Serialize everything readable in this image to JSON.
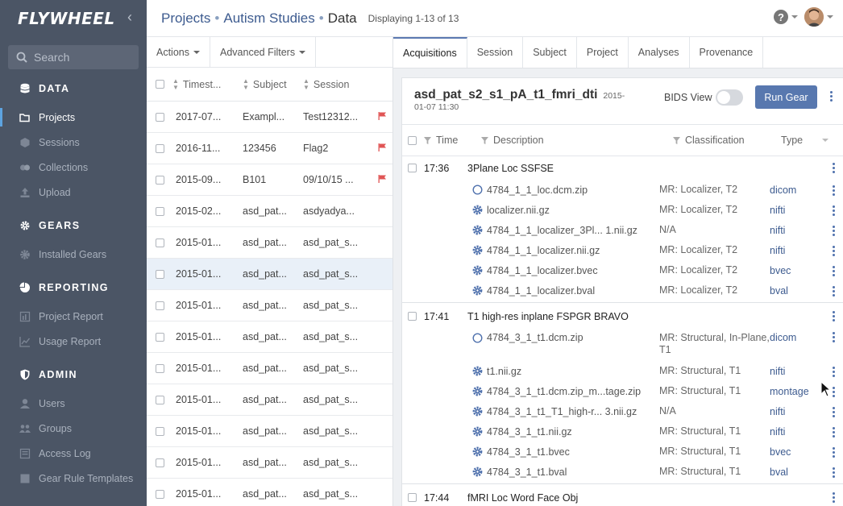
{
  "sidebar": {
    "logo": "FLYWHEEL",
    "search_placeholder": "Search",
    "sections": [
      {
        "title": "DATA",
        "items": [
          "Projects",
          "Sessions",
          "Collections",
          "Upload"
        ]
      },
      {
        "title": "GEARS",
        "items": [
          "Installed Gears"
        ]
      },
      {
        "title": "REPORTING",
        "items": [
          "Project Report",
          "Usage Report"
        ]
      },
      {
        "title": "ADMIN",
        "items": [
          "Users",
          "Groups",
          "Access Log",
          "Gear Rule Templates"
        ]
      }
    ],
    "active_item": "Projects"
  },
  "breadcrumb": {
    "project_root": "Projects",
    "project": "Autism Studies",
    "current": "Data",
    "sep": "•"
  },
  "displaying": "Displaying 1-13 of 13",
  "list": {
    "toolbar": {
      "actions": "Actions",
      "filters": "Advanced Filters"
    },
    "columns": [
      "Timest...",
      "Subject",
      "Session"
    ],
    "rows": [
      {
        "ts": "2017-07...",
        "subject": "Exampl...",
        "session": "Test12312...",
        "flag": true
      },
      {
        "ts": "2016-11...",
        "subject": "123456",
        "session": "Flag2",
        "flag": true
      },
      {
        "ts": "2015-09...",
        "subject": "B101",
        "session": "09/10/15 ...",
        "flag": true
      },
      {
        "ts": "2015-02...",
        "subject": "asd_pat...",
        "session": "asdyadya...",
        "flag": false
      },
      {
        "ts": "2015-01...",
        "subject": "asd_pat...",
        "session": "asd_pat_s...",
        "flag": false
      },
      {
        "ts": "2015-01...",
        "subject": "asd_pat...",
        "session": "asd_pat_s...",
        "flag": false,
        "selected": true
      },
      {
        "ts": "2015-01...",
        "subject": "asd_pat...",
        "session": "asd_pat_s...",
        "flag": false
      },
      {
        "ts": "2015-01...",
        "subject": "asd_pat...",
        "session": "asd_pat_s...",
        "flag": false
      },
      {
        "ts": "2015-01...",
        "subject": "asd_pat...",
        "session": "asd_pat_s...",
        "flag": false
      },
      {
        "ts": "2015-01...",
        "subject": "asd_pat...",
        "session": "asd_pat_s...",
        "flag": false
      },
      {
        "ts": "2015-01...",
        "subject": "asd_pat...",
        "session": "asd_pat_s...",
        "flag": false
      },
      {
        "ts": "2015-01...",
        "subject": "asd_pat...",
        "session": "asd_pat_s...",
        "flag": false
      },
      {
        "ts": "2015-01...",
        "subject": "asd_pat...",
        "session": "asd_pat_s...",
        "flag": false
      }
    ]
  },
  "tabs": [
    "Acquisitions",
    "Session",
    "Subject",
    "Project",
    "Analyses",
    "Provenance"
  ],
  "active_tab": "Acquisitions",
  "session_card": {
    "title": "asd_pat_s2_s1_pA_t1_fmri_dti",
    "date": "2015-01-07 11:30",
    "bids_label": "BIDS View",
    "run_gear": "Run Gear",
    "columns": [
      "Time",
      "Description",
      "Classification",
      "Type"
    ],
    "groups": [
      {
        "time": "17:36",
        "description": "3Plane Loc SSFSE",
        "files": [
          {
            "icon": "circle-icon",
            "name": "4784_1_1_loc.dcm.zip",
            "classification": "MR: Localizer, T2",
            "type": "dicom"
          },
          {
            "icon": "gear-icon",
            "name": "localizer.nii.gz",
            "classification": "MR: Localizer, T2",
            "type": "nifti"
          },
          {
            "icon": "gear-icon",
            "name": "4784_1_1_localizer_3Pl...   1.nii.gz",
            "classification": "N/A",
            "type": "nifti"
          },
          {
            "icon": "gear-icon",
            "name": "4784_1_1_localizer.nii.gz",
            "classification": "MR: Localizer, T2",
            "type": "nifti"
          },
          {
            "icon": "gear-icon",
            "name": "4784_1_1_localizer.bvec",
            "classification": "MR: Localizer, T2",
            "type": "bvec"
          },
          {
            "icon": "gear-icon",
            "name": "4784_1_1_localizer.bval",
            "classification": "MR: Localizer, T2",
            "type": "bval"
          }
        ]
      },
      {
        "time": "17:41",
        "description": "T1 high-res inplane FSPGR BRAVO",
        "files": [
          {
            "icon": "circle-icon",
            "name": "4784_3_1_t1.dcm.zip",
            "classification": "MR: Structural, In-Plane, T1",
            "type": "dicom",
            "tall": true
          },
          {
            "icon": "gear-icon",
            "name": "t1.nii.gz",
            "classification": "MR: Structural, T1",
            "type": "nifti"
          },
          {
            "icon": "gear-icon",
            "name": "4784_3_1_t1.dcm.zip_m...tage.zip",
            "classification": "MR: Structural, T1",
            "type": "montage"
          },
          {
            "icon": "gear-icon",
            "name": "4784_3_1_t1_T1_high-r...   3.nii.gz",
            "classification": "N/A",
            "type": "nifti"
          },
          {
            "icon": "gear-icon",
            "name": "4784_3_1_t1.nii.gz",
            "classification": "MR: Structural, T1",
            "type": "nifti"
          },
          {
            "icon": "gear-icon",
            "name": "4784_3_1_t1.bvec",
            "classification": "MR: Structural, T1",
            "type": "bvec"
          },
          {
            "icon": "gear-icon",
            "name": "4784_3_1_t1.bval",
            "classification": "MR: Structural, T1",
            "type": "bval"
          }
        ]
      },
      {
        "time": "17:44",
        "description": "fMRI Loc Word Face Obj",
        "files": []
      }
    ]
  },
  "colors": {
    "sidebar": "#4b5565",
    "accent": "#5878af",
    "link": "#3d5b8f",
    "flag": "#e05555"
  }
}
